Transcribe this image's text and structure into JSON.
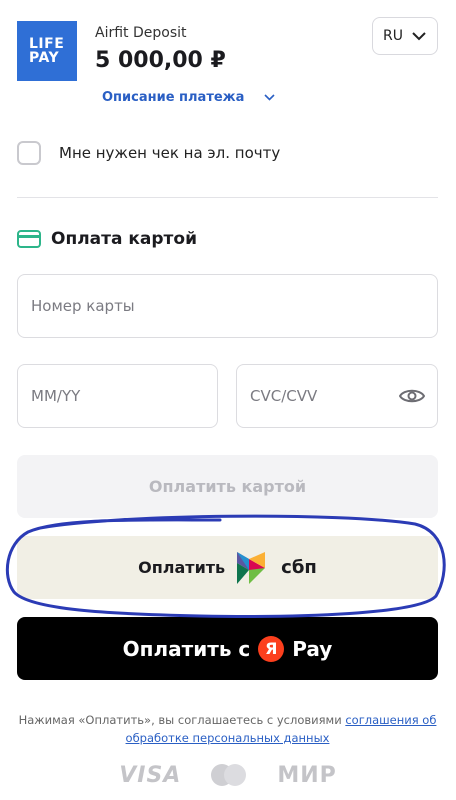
{
  "header": {
    "logo_line1": "LIFE",
    "logo_line2": "PAY",
    "merchant": "Airfit Deposit",
    "amount": "5 000,00 ₽",
    "language": "RU",
    "description_link": "Описание платежа"
  },
  "receipt": {
    "label": "Мне нужен чек на эл. почту",
    "checked": false
  },
  "card_section": {
    "title": "Оплата картой",
    "card_number_placeholder": "Номер карты",
    "expiry_placeholder": "MM/YY",
    "cvc_placeholder": "CVC/CVV",
    "pay_button": "Оплатить картой"
  },
  "sbp": {
    "label": "Оплатить",
    "brand": "сбп"
  },
  "yandex_pay": {
    "label": "Оплатить с",
    "logo_letter": "Я",
    "brand": "Pay"
  },
  "terms": {
    "text": "Нажимая «Оплатить», вы соглашаетесь с условиями ",
    "link": "соглашения об обработке персональных данных"
  },
  "brands": {
    "visa": "VISA",
    "mir": "МИР"
  },
  "colors": {
    "accent": "#2a5fc4",
    "logo_bg": "#2f6fd6",
    "card_icon": "#2db58a",
    "yandex_red": "#fc3f1d",
    "scribble": "#2b3bb5"
  }
}
